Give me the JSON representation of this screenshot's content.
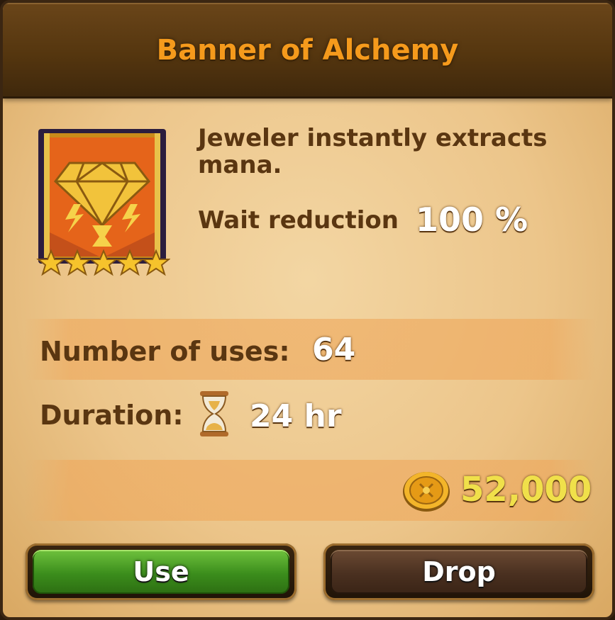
{
  "header": {
    "title": "Banner of Alchemy"
  },
  "item": {
    "icon": "banner-diamond-icon",
    "stars": 5,
    "description": "Jeweler instantly extracts mana.",
    "stat_label": "Wait reduction",
    "stat_value": "100 %"
  },
  "details": {
    "uses_label": "Number of uses:",
    "uses_value": "64",
    "duration_label": "Duration:",
    "duration_icon": "hourglass-icon",
    "duration_value": "24 hr",
    "price_icon": "gold-coin-icon",
    "price": "52,000"
  },
  "buttons": {
    "use_label": "Use",
    "drop_label": "Drop"
  },
  "colors": {
    "title": "#f59a1c",
    "label": "#5a3611",
    "price": "#f0e04a",
    "use_button": "#3b8d1c",
    "drop_button": "#4a3020"
  }
}
